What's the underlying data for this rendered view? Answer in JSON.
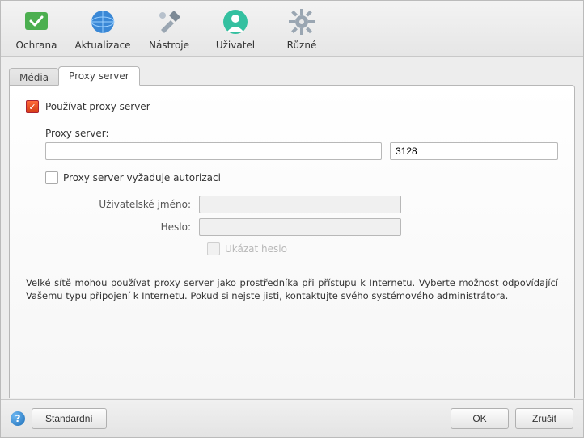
{
  "toolbar": {
    "items": [
      {
        "label": "Ochrana"
      },
      {
        "label": "Aktualizace"
      },
      {
        "label": "Nástroje"
      },
      {
        "label": "Uživatel"
      },
      {
        "label": "Různé"
      }
    ]
  },
  "tabs": {
    "media": "Média",
    "proxy": "Proxy server"
  },
  "proxy": {
    "use_label": "Používat proxy server",
    "server_label": "Proxy server:",
    "server_value": "",
    "port_value": "3128",
    "auth_label": "Proxy server vyžaduje autorizaci",
    "user_label": "Uživatelské jméno:",
    "user_value": "",
    "pass_label": "Heslo:",
    "pass_value": "",
    "showpw_label": "Ukázat heslo",
    "description": "Velké sítě mohou používat proxy server jako prostředníka při přístupu k Internetu. Vyberte možnost odpovídající Vašemu typu připojení k Internetu. Pokud si nejste jisti, kontaktujte svého systémového administrátora."
  },
  "footer": {
    "default": "Standardní",
    "ok": "OK",
    "cancel": "Zrušit"
  }
}
